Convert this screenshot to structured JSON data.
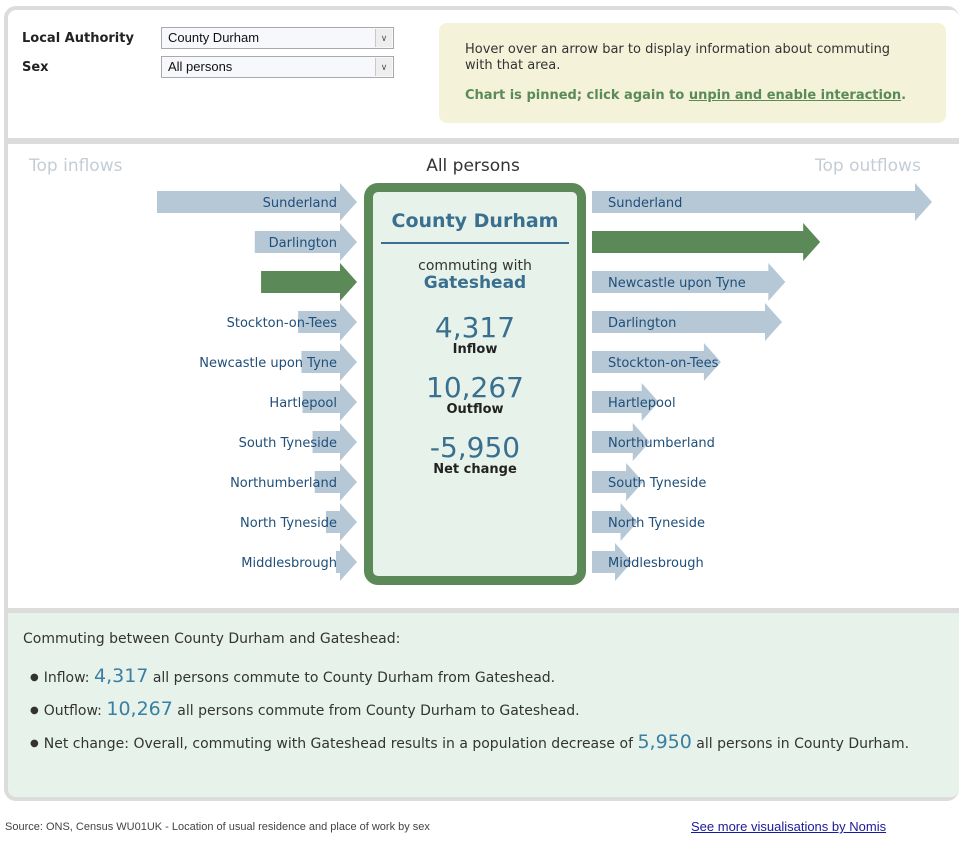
{
  "controls": {
    "local_authority_label": "Local Authority",
    "local_authority_value": "County Durham",
    "sex_label": "Sex",
    "sex_value": "All persons"
  },
  "hint": {
    "text": "Hover over an arrow bar to display information about commuting with that area.",
    "pinned_prefix": "Chart is pinned; click again to ",
    "pinned_link": "unpin and enable interaction",
    "pinned_suffix": "."
  },
  "chart_data": {
    "type": "bar",
    "title": "All persons",
    "left_title": "Top inflows",
    "right_title": "Top outflows",
    "units": "all persons commuting (estimated from arrow length)",
    "selected_area": "Gateshead",
    "inflows": [
      {
        "area": "Sunderland",
        "value": 9000
      },
      {
        "area": "Darlington",
        "value": 4600
      },
      {
        "area": "Gateshead",
        "value": 4317,
        "selected": true
      },
      {
        "area": "Stockton-on-Tees",
        "value": 2650
      },
      {
        "area": "Newcastle upon Tyne",
        "value": 2500
      },
      {
        "area": "Hartlepool",
        "value": 2450
      },
      {
        "area": "South Tyneside",
        "value": 2000
      },
      {
        "area": "Northumberland",
        "value": 1900
      },
      {
        "area": "North Tyneside",
        "value": 1400
      },
      {
        "area": "Middlesbrough",
        "value": 900
      }
    ],
    "outflows": [
      {
        "area": "Sunderland",
        "value": 15300
      },
      {
        "area": "Gateshead",
        "value": 10267,
        "selected": true
      },
      {
        "area": "Newcastle upon Tyne",
        "value": 8700
      },
      {
        "area": "Darlington",
        "value": 8550
      },
      {
        "area": "Stockton-on-Tees",
        "value": 5800
      },
      {
        "area": "Hartlepool",
        "value": 3000
      },
      {
        "area": "Northumberland",
        "value": 2600
      },
      {
        "area": "South Tyneside",
        "value": 2300
      },
      {
        "area": "North Tyneside",
        "value": 2050
      },
      {
        "area": "Middlesbrough",
        "value": 1800
      }
    ],
    "colors": {
      "bar": "#b6c8d6",
      "selected": "#5b8a58",
      "label": "#1f4e79"
    }
  },
  "center": {
    "area": "County Durham",
    "commuting_with_label": "commuting with",
    "partner": "Gateshead",
    "inflow_value": "4,317",
    "inflow_label": "Inflow",
    "outflow_value": "10,267",
    "outflow_label": "Outflow",
    "net_value": "-5,950",
    "net_label": "Net change"
  },
  "info": {
    "title": "Commuting between County Durham and Gateshead:",
    "inflow_prefix": "Inflow: ",
    "inflow_value": "4,317",
    "inflow_suffix": " all persons commute to County Durham from Gateshead.",
    "outflow_prefix": "Outflow: ",
    "outflow_value": "10,267",
    "outflow_suffix": " all persons commute from County Durham to Gateshead.",
    "net_prefix": "Net change: Overall, commuting with Gateshead results in a population decrease of ",
    "net_value": "5,950",
    "net_suffix": " all persons in County Durham."
  },
  "footer": {
    "source": "Source: ONS, Census WU01UK - Location of usual residence and place of work by sex",
    "more_link": "See more visualisations by Nomis"
  }
}
